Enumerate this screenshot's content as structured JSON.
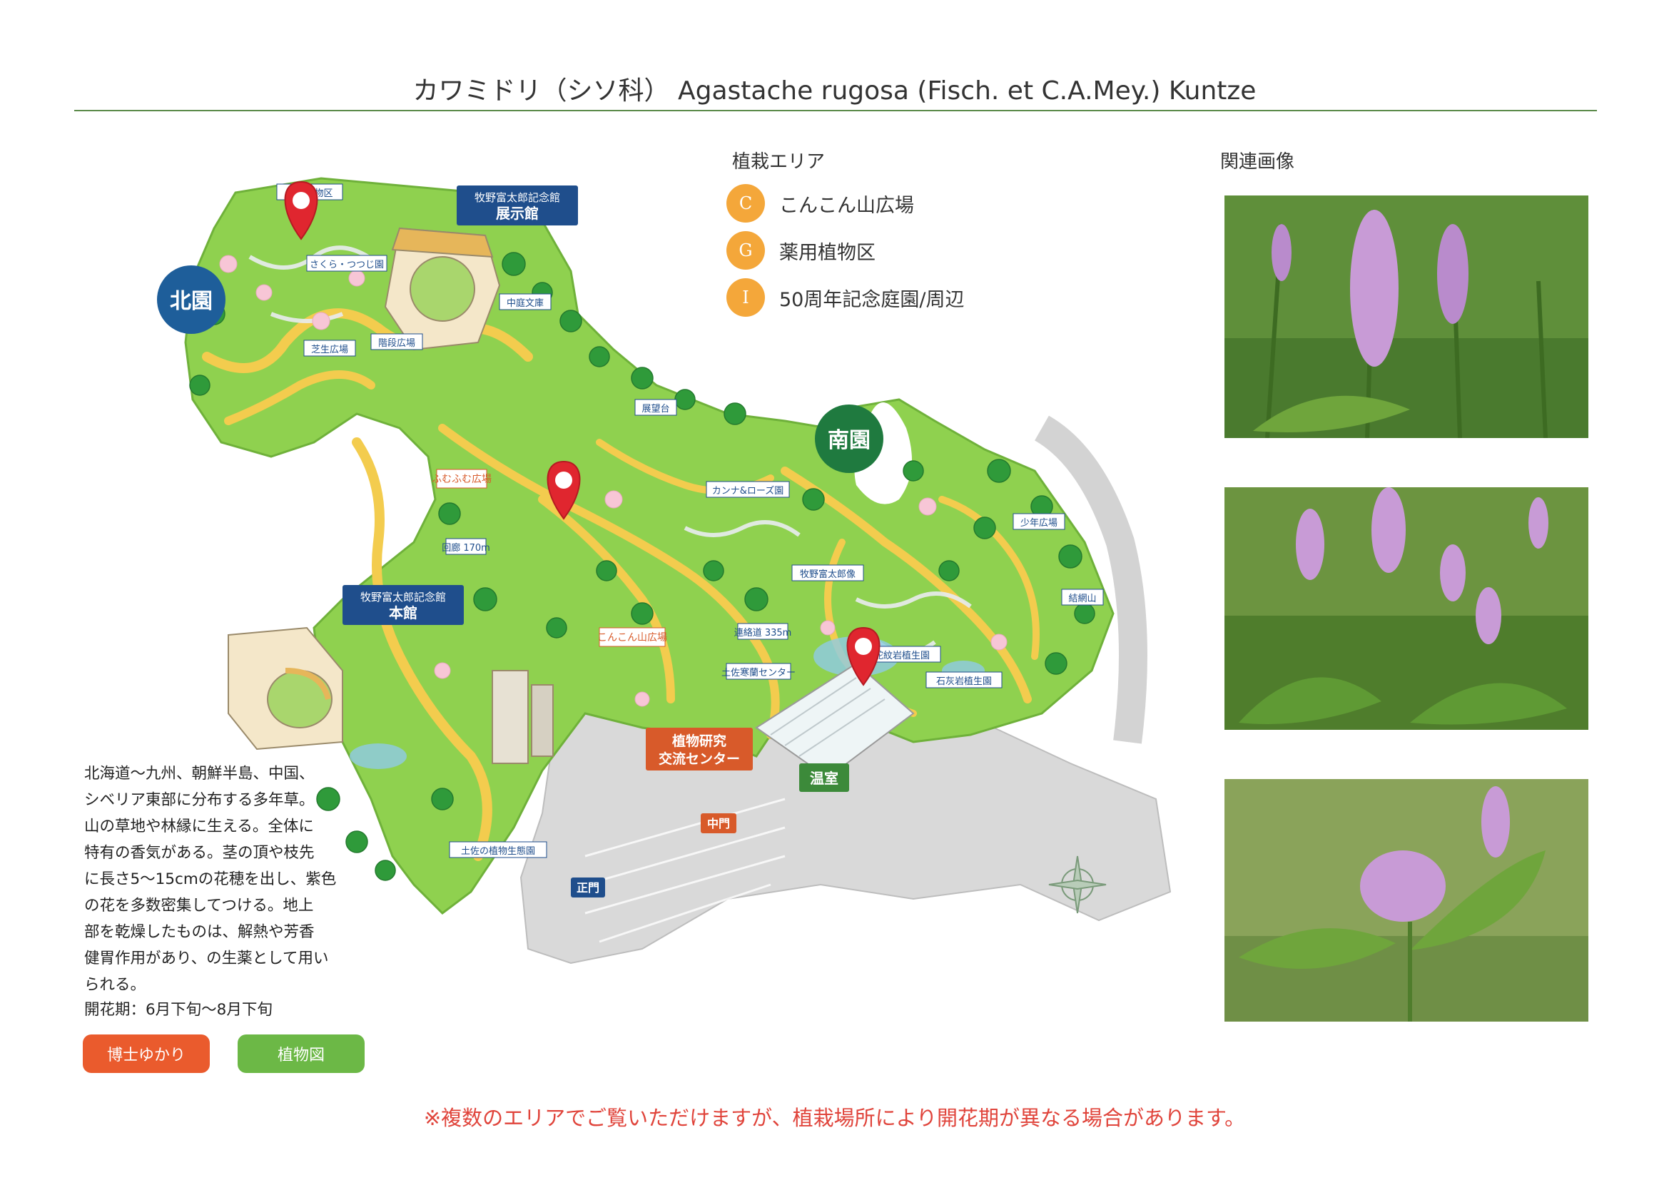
{
  "header": {
    "title": "カワミドリ（シソ科） Agastache rugosa (Fisch. et C.A.Mey.) Kuntze"
  },
  "planting_area": {
    "heading": "植栽エリア",
    "items": [
      {
        "code": "C",
        "label": "こんこん山広場"
      },
      {
        "code": "G",
        "label": "薬用植物区"
      },
      {
        "code": "I",
        "label": "50周年記念庭園/周辺"
      }
    ],
    "badge_color": "#f4a73a"
  },
  "related_images": {
    "heading": "関連画像"
  },
  "description": {
    "lines": [
      "北海道〜九州、朝鮮半島、中国、",
      "シベリア東部に分布する多年草。",
      "山の草地や林縁に生える。全体に",
      "特有の香気がある。茎の頂や枝先",
      "に長さ5〜15cmの花穂を出し、紫色",
      "の花を多数密集してつける。地上",
      "部を乾燥したものは、解熱や芳香",
      "健胃作用があり、の生薬として用い",
      "られる。"
    ],
    "bloom_period": "開花期：6月下旬〜8月下旬"
  },
  "buttons": {
    "doctor": "博士ゆかり",
    "illustration": "植物図"
  },
  "notice": "※複数のエリアでご覧いただけますが、植栽場所により開花期が異なる場合があります。",
  "map": {
    "north_garden": "北園",
    "south_garden": "南園",
    "labels": {
      "yakuyo": "薬用植物区",
      "sakura": "さくら・つつじ園",
      "museum_exhibit_1": "牧野富太郎記念館",
      "museum_exhibit_2": "展示館",
      "nakaniwa": "中庭文庫",
      "shiba": "芝生広場",
      "kaidan": "階段広場",
      "tenbodai": "展望台",
      "fumufumu": "ふむふむ広場",
      "kairo": "回廊 170m",
      "cannas": "カンナ&ローズ園",
      "statue": "牧野富太郎像",
      "shonen": "少年広場",
      "kekkai": "結網山",
      "museum_main_1": "牧野富太郎記念館",
      "museum_main_2": "本館",
      "konkon": "こんこん山広場",
      "renraku": "連絡道 335m",
      "tosa_kanran": "土佐寒蘭センター",
      "jamon": "蛇紋岩植生園",
      "sekkai": "石灰岩植生園",
      "research_1": "植物研究",
      "research_2": "交流センター",
      "onshitsu": "温室",
      "tosa_ecology": "土佐の植物生態園",
      "main_gate": "正門",
      "middle_gate": "中門"
    },
    "colors": {
      "grass": "#8fd14f",
      "path": "#f3cc4e",
      "tree": "#2f9a3a",
      "north_badge": "#1e5e9a",
      "south_badge": "#1f7a3f",
      "pin": "#e0262f",
      "sign_blue": "#1f4e8c",
      "sign_orange": "#d85a2a",
      "sign_green": "#3c8a3a"
    }
  }
}
